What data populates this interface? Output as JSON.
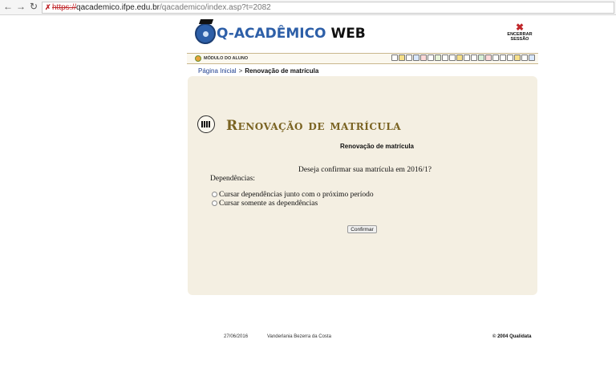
{
  "browser": {
    "scheme": "https://",
    "host": "qacademico.ifpe.edu.br",
    "path": "/qacademico/index.asp?t=2082"
  },
  "header": {
    "logo_prefix": "Q-ACADÊMICO",
    "logo_suffix": "WEB",
    "logout_label_line1": "ENCERRAR",
    "logout_label_line2": "SESSÃO"
  },
  "module": {
    "label": "MÓDULO DO ALUNO",
    "toolbar_count": 20
  },
  "breadcrumb": {
    "home": "Página Inicial",
    "separator": ">",
    "current": "Renovação de matrícula"
  },
  "main": {
    "title": "Renovação de matrícula",
    "subtitle": "Renovação de matrícula",
    "question": "Deseja confirmar sua matrícula em 2016/1?",
    "dependencies_label": "Dependências:",
    "options": [
      {
        "label": "Cursar dependências junto com o próximo período",
        "selected": false
      },
      {
        "label": "Cursar somente as dependências",
        "selected": false
      }
    ],
    "confirm_button": "Confirmar"
  },
  "footer": {
    "date": "27/06/2016",
    "user": "Vanderlania Bezerra da Costa",
    "copyright": "© 2004 Qualidata"
  },
  "colors": {
    "panel_bg": "#f4efe2",
    "title_color": "#7a6322",
    "logo_blue": "#2d5fa8"
  }
}
